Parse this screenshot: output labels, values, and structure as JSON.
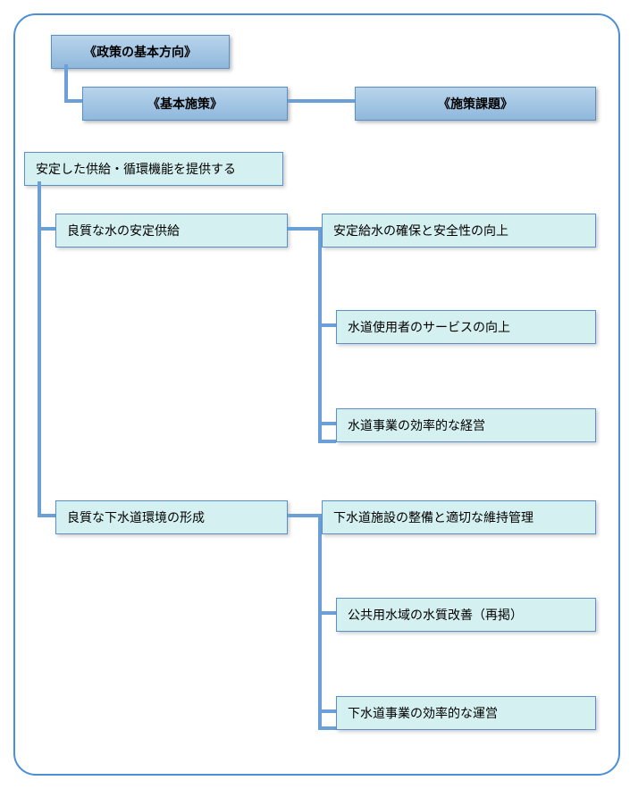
{
  "h1": "《政策の基本方向》",
  "h2": "《基本施策》",
  "h3": "《施策課題》",
  "root": "安定した供給・循環機能を提供する",
  "m1": "良質な水の安定供給",
  "m2": "良質な下水道環境の形成",
  "i1": "安定給水の確保と安全性の向上",
  "i2": "水道使用者のサービスの向上",
  "i3": "水道事業の効率的な経営",
  "i4": "下水道施設の整備と適切な維持管理",
  "i5": "公共用水域の水質改善（再掲）",
  "i6": "下水道事業の効率的な運営"
}
